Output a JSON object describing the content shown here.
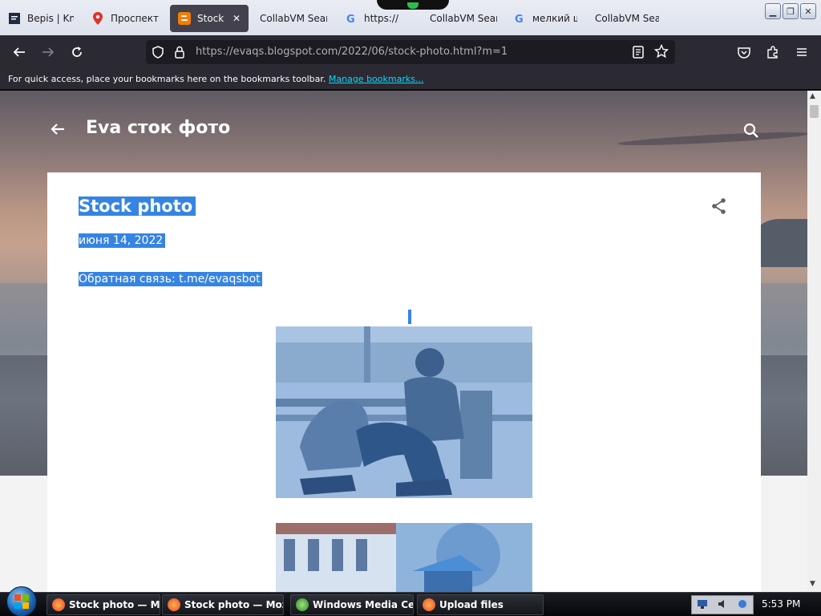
{
  "browser": {
    "tabs": [
      {
        "label": "Верis | Kno",
        "icon": "bookmark-site-icon",
        "active": false
      },
      {
        "label": "Проспект",
        "icon": "map-pin-icon",
        "active": false
      },
      {
        "label": "Stock ph",
        "icon": "blogger-icon",
        "active": true
      },
      {
        "label": "CollabVM Sear",
        "icon": "",
        "active": false
      },
      {
        "label": "https://",
        "icon": "google-icon",
        "active": false
      },
      {
        "label": "CollabVM Sear",
        "icon": "",
        "active": false
      },
      {
        "label": "мелкий шр",
        "icon": "google-icon",
        "active": false
      },
      {
        "label": "CollabVM Sear",
        "icon": "",
        "active": false
      }
    ],
    "url_host": "https://evaqs.blogspot.com",
    "url_path": "/2022/06/stock-photo.html?m=1",
    "bookmarks_message": "For quick access, place your bookmarks here on the bookmarks toolbar.",
    "manage_bookmarks_label": "Manage bookmarks..."
  },
  "page": {
    "blog_title": "Eva сток фото",
    "post": {
      "title": "Stock photo",
      "date": "июня 14, 2022",
      "feedback": "Обратная связь: t.me/evaqsbot"
    }
  },
  "taskbar": {
    "items": [
      {
        "label": "Stock photo — Mozil...",
        "icon": "firefox-icon"
      },
      {
        "label": "Stock photo — Mozil...",
        "icon": "firefox-icon"
      },
      {
        "label": "Windows Media Cen...",
        "icon": "windows-media-center-icon"
      },
      {
        "label": "Upload files",
        "icon": "upload-icon"
      }
    ],
    "clock": "5:53 PM"
  },
  "colors": {
    "selection": "#3584e4",
    "toolbar": "#2b2a33",
    "link": "#00ddff"
  }
}
